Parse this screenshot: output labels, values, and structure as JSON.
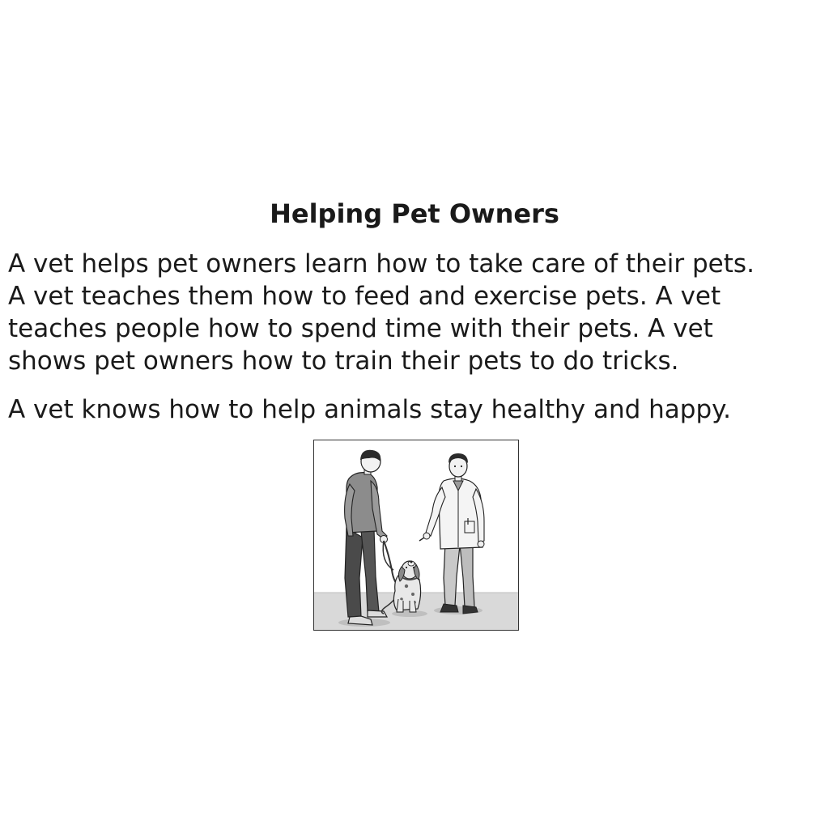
{
  "document": {
    "title": "Helping Pet Owners",
    "paragraph1_lines": [
      "A vet helps pet owners learn how to take care of their pets.",
      "A vet teaches them how to feed and exercise pets. A vet",
      "teaches people how to spend time with their pets. A vet",
      "shows pet owners how to train their pets to do tricks."
    ],
    "paragraph2": "A vet knows how to help animals stay healthy and happy."
  },
  "colors": {
    "text": "#1a1a1a",
    "floor": "#d9d9d9",
    "border": "#333333"
  }
}
